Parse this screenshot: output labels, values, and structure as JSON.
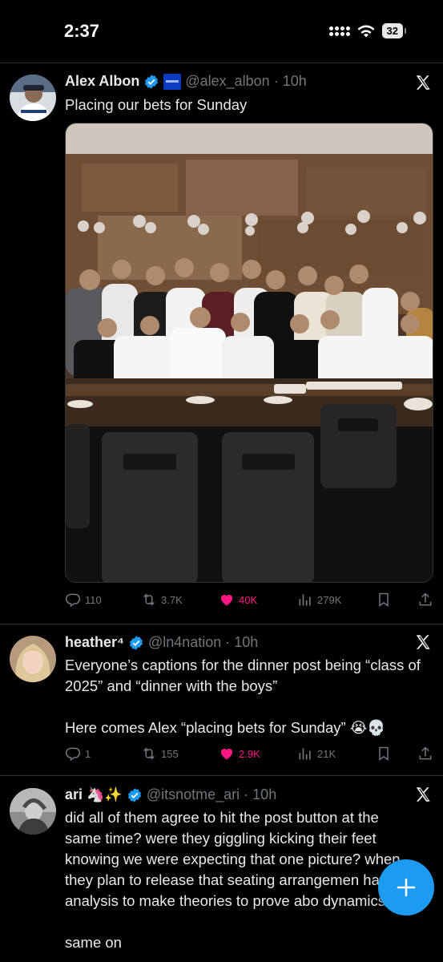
{
  "status_bar": {
    "time": "2:37",
    "battery": "32"
  },
  "tweets": [
    {
      "name": "Alex Albon",
      "handle": "@alex_albon",
      "time": "10h",
      "text": "Placing our bets for Sunday",
      "actions": {
        "replies": "110",
        "retweets": "3.7K",
        "likes": "40K",
        "views": "279K"
      }
    },
    {
      "name": "heather⁴",
      "handle": "@ln4nation",
      "time": "10h",
      "text": "Everyone’s captions for the dinner post being “class of 2025” and “dinner with the boys”\n\nHere comes Alex “placing bets for Sunday” 😭💀",
      "actions": {
        "replies": "1",
        "retweets": "155",
        "likes": "2.9K",
        "views": "21K"
      }
    },
    {
      "name": "ari 🦄✨",
      "handle": "@itsnotme_ari",
      "time": "10h",
      "text": "did all of them agree to hit the post button at the same time? were they giggling kicking their feet knowing we were expecting that one picture? when they plan to release that seating arrangemen have analysis to make theories to prove abo dynamics\n\nsame on"
    }
  ],
  "icons": {
    "verified": "verified-badge-icon",
    "x_logo": "x-logo-icon",
    "reply": "reply-icon",
    "retweet": "retweet-icon",
    "like": "heart-icon",
    "views": "views-icon",
    "bookmark": "bookmark-icon",
    "share": "share-icon",
    "compose": "plus-icon"
  },
  "colors": {
    "accent": "#1d9bf0",
    "like": "#f91880",
    "muted": "#71767b",
    "background": "#000000"
  }
}
